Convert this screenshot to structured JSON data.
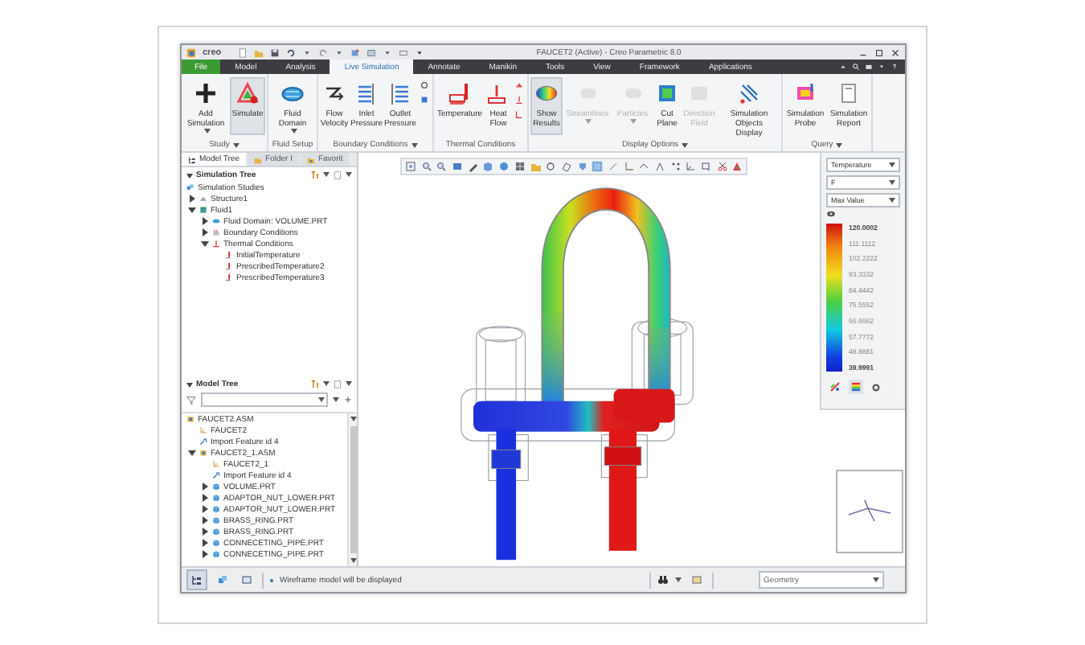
{
  "window": {
    "logo": "creo",
    "title": "FAUCET2 (Active) - Creo Parametric 8.0"
  },
  "ribbon_tabs": [
    {
      "label": "File",
      "kind": "file",
      "selected": false
    },
    {
      "label": "Model",
      "kind": "tab",
      "selected": false
    },
    {
      "label": "Analysis",
      "kind": "tab",
      "selected": false
    },
    {
      "label": "Live Simulation",
      "kind": "tab",
      "selected": true
    },
    {
      "label": "Annotate",
      "kind": "tab",
      "selected": false
    },
    {
      "label": "Manikin",
      "kind": "tab",
      "selected": false
    },
    {
      "label": "Tools",
      "kind": "tab",
      "selected": false
    },
    {
      "label": "View",
      "kind": "tab",
      "selected": false
    },
    {
      "label": "Framework",
      "kind": "tab",
      "selected": false
    },
    {
      "label": "Applications",
      "kind": "tab",
      "selected": false
    }
  ],
  "ribbon_groups": [
    {
      "label": "Study",
      "menu": true,
      "buttons": [
        {
          "label": "Add Simulation",
          "menu": true,
          "selected": false,
          "disabled": false
        },
        {
          "label": "Simulate",
          "menu": false,
          "selected": true,
          "disabled": false
        }
      ]
    },
    {
      "label": "Fluid Setup",
      "menu": false,
      "buttons": [
        {
          "label": "Fluid Domain",
          "menu": true,
          "selected": false,
          "disabled": false
        }
      ]
    },
    {
      "label": "Boundary Conditions",
      "menu": true,
      "buttons": [
        {
          "label": "Flow Velocity",
          "menu": false,
          "selected": false,
          "disabled": false
        },
        {
          "label": "Inlet Pressure",
          "menu": false,
          "selected": false,
          "disabled": false
        },
        {
          "label": "Outlet Pressure",
          "menu": false,
          "selected": false,
          "disabled": false
        }
      ]
    },
    {
      "label": "Thermal Conditions",
      "menu": false,
      "buttons": [
        {
          "label": "Temperature",
          "menu": false,
          "selected": false,
          "disabled": false
        },
        {
          "label": "Heat Flow",
          "menu": false,
          "selected": false,
          "disabled": false
        }
      ]
    },
    {
      "label": "Display Options",
      "menu": true,
      "buttons": [
        {
          "label": "Show Results",
          "menu": false,
          "selected": true,
          "disabled": false
        },
        {
          "label": "Streamlines",
          "menu": true,
          "selected": false,
          "disabled": true
        },
        {
          "label": "Particles",
          "menu": true,
          "selected": false,
          "disabled": true
        },
        {
          "label": "Cut Plane",
          "menu": false,
          "selected": false,
          "disabled": false
        },
        {
          "label": "Direction Field",
          "menu": false,
          "selected": false,
          "disabled": true
        },
        {
          "label": "Simulation Objects Display",
          "menu": false,
          "selected": false,
          "disabled": false
        }
      ]
    },
    {
      "label": "Query",
      "menu": true,
      "buttons": [
        {
          "label": "Simulation Probe",
          "menu": false,
          "selected": false,
          "disabled": false
        },
        {
          "label": "Simulation Report",
          "menu": false,
          "selected": false,
          "disabled": false
        }
      ]
    }
  ],
  "panel_tabs": [
    {
      "label": "Model Tree",
      "selected": true
    },
    {
      "label": "Folder I",
      "selected": false
    },
    {
      "label": "Favorit",
      "selected": false
    }
  ],
  "simulation_tree": {
    "title": "Simulation Tree",
    "items": [
      {
        "label": "Simulation Studies",
        "kind": "studies",
        "children": [
          {
            "label": "Structure1",
            "kind": "structure",
            "expanded": false
          },
          {
            "label": "Fluid1",
            "kind": "fluid",
            "expanded": true,
            "children": [
              {
                "label": "Fluid Domain: VOLUME.PRT",
                "kind": "domain",
                "expanded": false
              },
              {
                "label": "Boundary Conditions",
                "kind": "boundary",
                "expanded": false
              },
              {
                "label": "Thermal Conditions",
                "kind": "thermal",
                "expanded": true,
                "children": [
                  {
                    "label": "InitialTemperature",
                    "kind": "temperature"
                  },
                  {
                    "label": "PrescribedTemperature2",
                    "kind": "temperature"
                  },
                  {
                    "label": "PrescribedTemperature3",
                    "kind": "temperature"
                  }
                ]
              }
            ]
          }
        ]
      }
    ]
  },
  "model_tree": {
    "title": "Model Tree",
    "items": [
      {
        "label": "FAUCET2.ASM",
        "kind": "assembly",
        "children": [
          {
            "label": "FAUCET2",
            "kind": "csys"
          },
          {
            "label": "Import Feature id 4",
            "kind": "import"
          },
          {
            "label": "FAUCET2_1.ASM",
            "kind": "assembly",
            "expanded": true,
            "children": [
              {
                "label": "FAUCET2_1",
                "kind": "csys"
              },
              {
                "label": "Import Feature id 4",
                "kind": "import"
              },
              {
                "label": "VOLUME.PRT",
                "kind": "part",
                "expanded": false
              },
              {
                "label": "ADAPTOR_NUT_LOWER.PRT",
                "kind": "part",
                "expanded": false
              },
              {
                "label": "ADAPTOR_NUT_LOWER.PRT",
                "kind": "part",
                "expanded": false
              },
              {
                "label": "BRASS_RING.PRT",
                "kind": "part",
                "expanded": false
              },
              {
                "label": "BRASS_RING.PRT",
                "kind": "part",
                "expanded": false
              },
              {
                "label": "CONNECETING_PIPE.PRT",
                "kind": "part",
                "expanded": false
              },
              {
                "label": "CONNECETING_PIPE.PRT",
                "kind": "part",
                "expanded": false
              }
            ]
          }
        ]
      }
    ]
  },
  "legend": {
    "quantity": "Temperature",
    "unit": "F",
    "mode": "Max Value",
    "values": [
      "120.0002",
      "111.1112",
      "102.2222",
      "93.3332",
      "84.4442",
      "75.5552",
      "66.6662",
      "57.7772",
      "48.8881",
      "39.9991"
    ]
  },
  "status_bar": {
    "message": "Wireframe model will be displayed",
    "filter": "Geometry"
  }
}
